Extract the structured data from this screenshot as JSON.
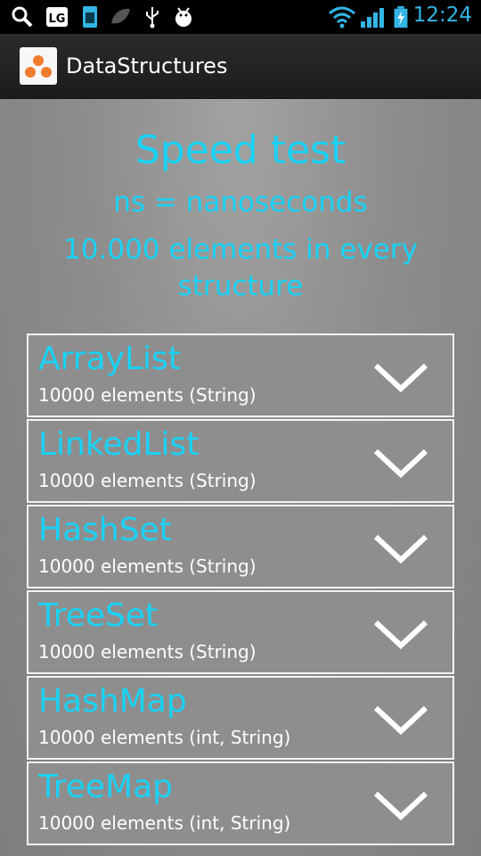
{
  "status_bar": {
    "time": "12:24",
    "icons": [
      "search-icon",
      "lg-icon",
      "sd-card-icon",
      "leaf-icon",
      "usb-icon",
      "android-debug-icon",
      "wifi-icon",
      "signal-icon",
      "battery-icon"
    ]
  },
  "app_bar": {
    "title": "DataStructures"
  },
  "main": {
    "title": "Speed test",
    "subtitle": "ns = nanoseconds",
    "description": "10.000 elements in every structure"
  },
  "structures": [
    {
      "name": "ArrayList",
      "detail": "10000 elements (String)"
    },
    {
      "name": "LinkedList",
      "detail": "10000 elements (String)"
    },
    {
      "name": "HashSet",
      "detail": "10000 elements (String)"
    },
    {
      "name": "TreeSet",
      "detail": "10000 elements (String)"
    },
    {
      "name": "HashMap",
      "detail": "10000 elements (int, String)"
    },
    {
      "name": "TreeMap",
      "detail": "10000 elements (int, String)"
    }
  ],
  "colors": {
    "accent": "#1ad2f5",
    "status_accent": "#33b5e5",
    "app_icon_orange": "#f07c2d"
  }
}
